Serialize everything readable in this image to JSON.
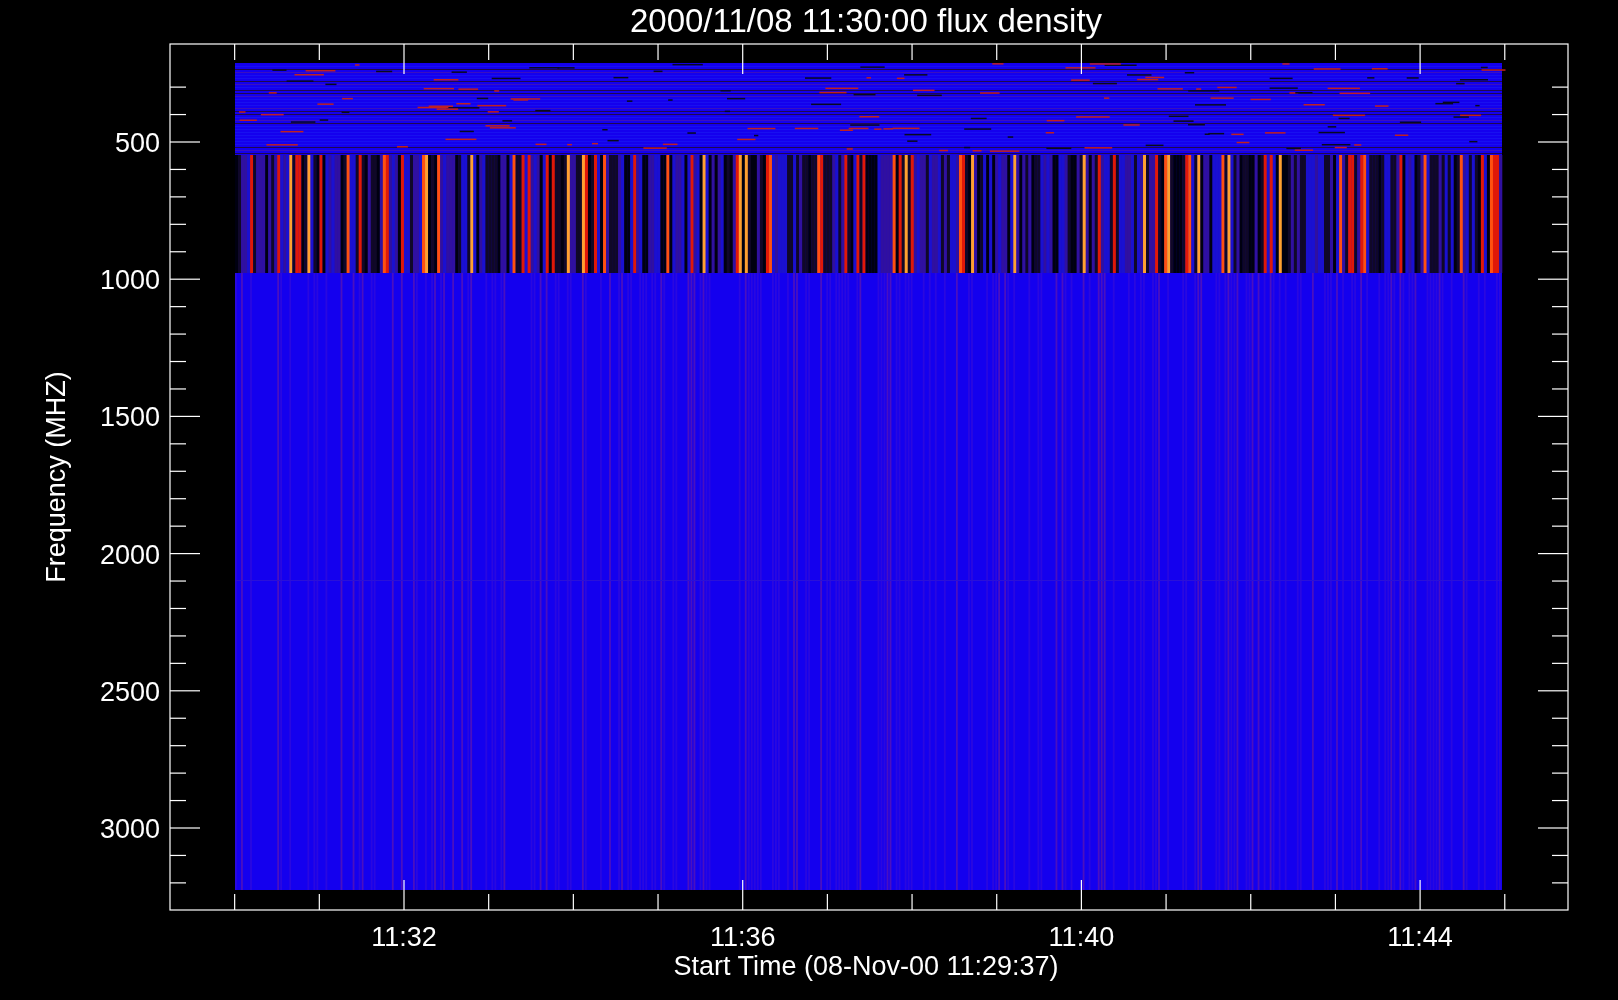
{
  "title": "2000/11/08 11:30:00 flux density",
  "y_axis": {
    "label": "Frequency (MHZ)",
    "ticks": [
      "500",
      "1000",
      "1500",
      "2000",
      "2500",
      "3000"
    ]
  },
  "x_axis": {
    "label": "Start Time (08-Nov-00 11:29:37)",
    "ticks": [
      "11:32",
      "11:36",
      "11:40",
      "11:44"
    ]
  }
}
